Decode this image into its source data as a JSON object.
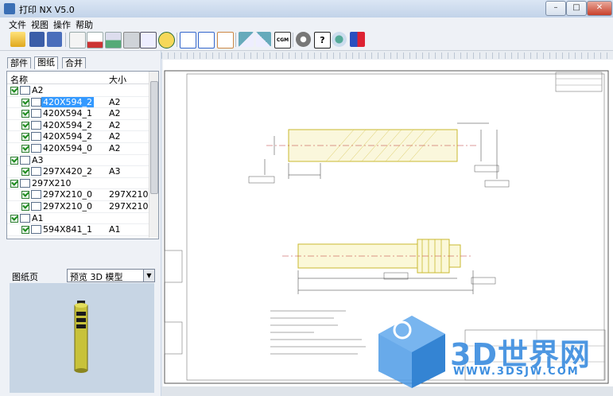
{
  "window": {
    "title": "打印 NX V5.0",
    "min": "–",
    "max": "□",
    "close": "✕"
  },
  "menu": [
    "文件",
    "视图",
    "操作",
    "帮助"
  ],
  "toolbar_icons": [
    "open-folder-icon",
    "save-icon",
    "save-all-icon",
    "print-preview-icon",
    "export-pdf-icon",
    "print-setup-icon",
    "printer-icon",
    "plotter-icon",
    "clock-icon",
    "close-doc-icon",
    "zoom-window-icon",
    "zoom-page-icon",
    "rotate-left-icon",
    "rotate-right-icon",
    "cgm-icon",
    "settings-gear-icon",
    "help-icon",
    "web-icon",
    "app-logo-icon"
  ],
  "toolbar_text": {
    "cgm": "CGM",
    "help": "?"
  },
  "tabs": [
    "部件",
    "图纸",
    "合并"
  ],
  "tree": {
    "headers": {
      "name": "名称",
      "size": "大小"
    },
    "rows": [
      {
        "name": "A2",
        "size": "",
        "level": 0
      },
      {
        "name": "420X594_2",
        "size": "A2",
        "level": 1,
        "selected": true
      },
      {
        "name": "420X594_1",
        "size": "A2",
        "level": 1
      },
      {
        "name": "420X594_2",
        "size": "A2",
        "level": 1
      },
      {
        "name": "420X594_2",
        "size": "A2",
        "level": 1
      },
      {
        "name": "420X594_0",
        "size": "A2",
        "level": 1
      },
      {
        "name": "A3",
        "size": "",
        "level": 0
      },
      {
        "name": "297X420_2",
        "size": "A3",
        "level": 1
      },
      {
        "name": "297X210",
        "size": "",
        "level": 0
      },
      {
        "name": "297X210_0",
        "size": "297X210",
        "level": 1
      },
      {
        "name": "297X210_0",
        "size": "297X210",
        "level": 1
      },
      {
        "name": "A1",
        "size": "",
        "level": 0
      },
      {
        "name": "594X841_1",
        "size": "A1",
        "level": 1
      }
    ]
  },
  "sheet": {
    "label": "图纸页",
    "selected": "预览 3D 模型"
  },
  "watermark": {
    "brand": "3D世界网",
    "url": "WWW.3DSJW.COM"
  },
  "colors": {
    "selection": "#3399ff",
    "part": "#e8e44a",
    "watermark": "#3e8fe0"
  }
}
